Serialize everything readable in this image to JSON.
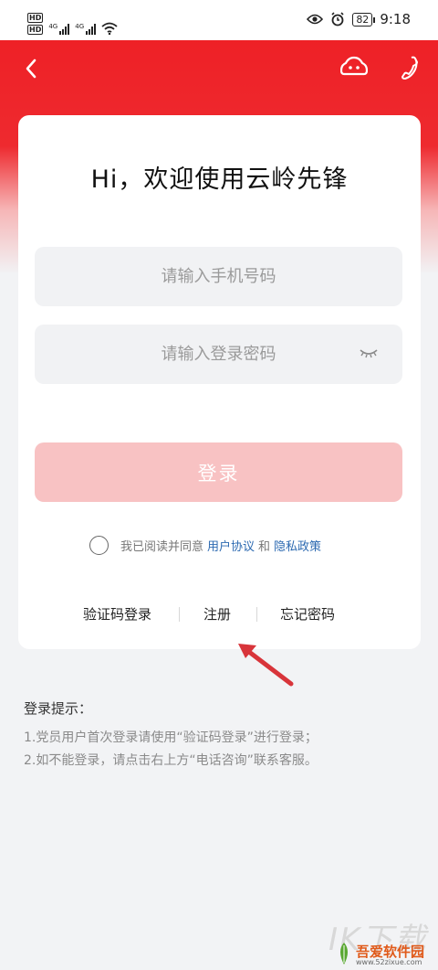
{
  "status_bar": {
    "hd1": "HD",
    "hd2": "HD",
    "net1": "4G",
    "net2": "4G",
    "battery": "82",
    "time": "9:18"
  },
  "nav": {
    "back_icon": "chevron-left-icon",
    "robot_icon": "robot-icon",
    "phone_icon": "phone-icon"
  },
  "login": {
    "title": "Hi，欢迎使用云岭先锋",
    "phone_placeholder": "请输入手机号码",
    "password_placeholder": "请输入登录密码",
    "login_button": "登录",
    "agree_text": "我已阅读并同意",
    "user_agreement": "用户协议",
    "and_text": "和",
    "privacy_policy": "隐私政策",
    "sms_login": "验证码登录",
    "register": "注册",
    "forgot_password": "忘记密码"
  },
  "tips": {
    "title": "登录提示：",
    "line1": "1.党员用户首次登录请使用“验证码登录”进行登录；",
    "line2": "2.如不能登录，请点击右上方“电话咨询”联系客服。"
  },
  "watermark": {
    "big": "IK下载",
    "logo": "吾爱软件园",
    "url": "www.52zixue.com"
  },
  "colors": {
    "brand_red": "#ee1d23",
    "login_button_disabled": "#f8c2c3",
    "link_blue": "#2d6ab1"
  }
}
